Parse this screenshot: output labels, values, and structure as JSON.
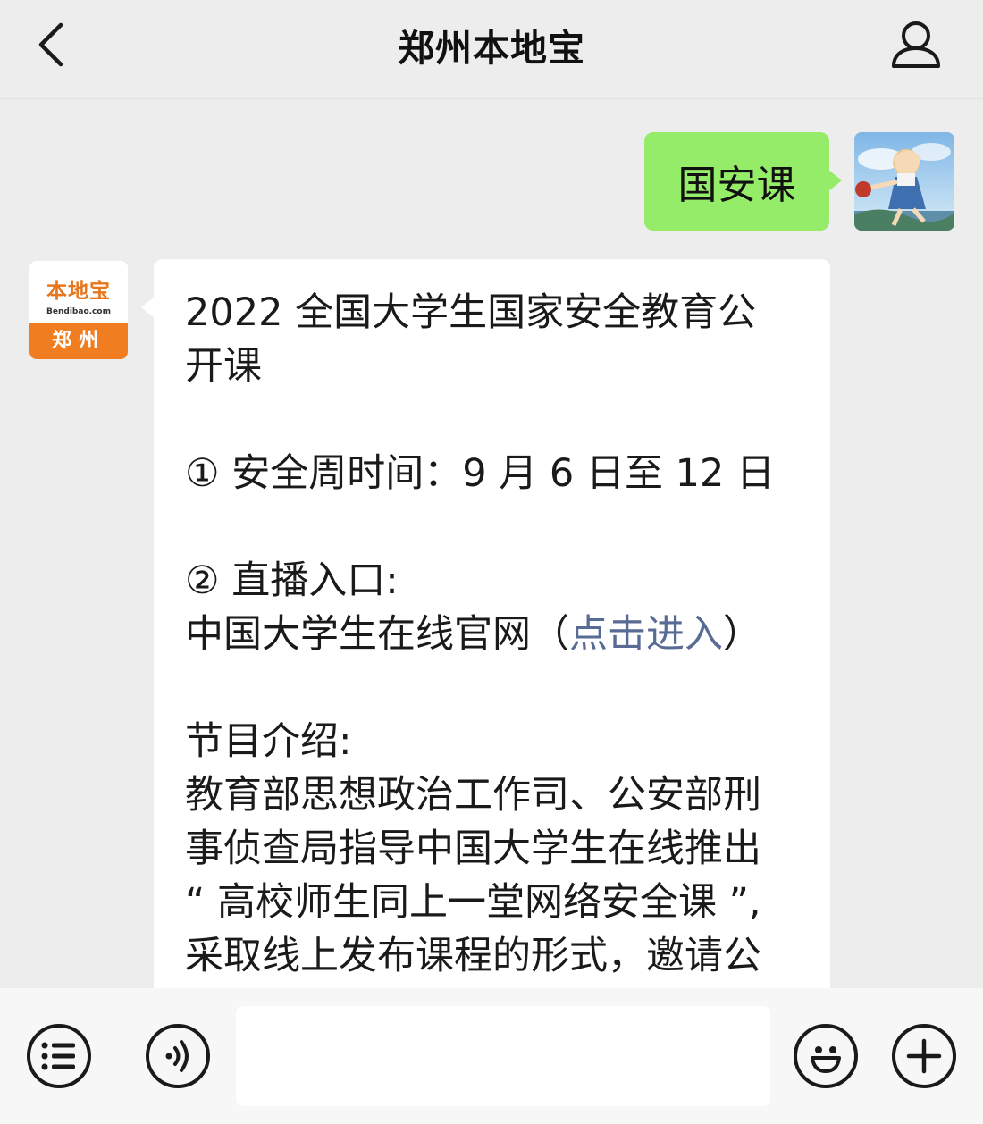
{
  "header": {
    "title": "郑州本地宝",
    "back_icon": "chevron-left-icon",
    "profile_icon": "user-icon"
  },
  "chat": {
    "sent_message": "国安课",
    "bot_avatar": {
      "logo_text": "本地宝",
      "logo_url_text": "Bendibao.com",
      "city_label": "郑州"
    },
    "received_message": {
      "title_line1": "2022 全国大学生国家安全教育公",
      "title_line2": "开课",
      "item1": "① 安全周时间：9 月 6 日至 12 日",
      "item2_label": "② 直播入口:",
      "item2_prefix": "中国大学生在线官网（",
      "item2_link": "点击进入",
      "item2_suffix": "）",
      "intro_label": "节目介绍:",
      "intro_line1": "教育部思想政治工作司、公安部刑",
      "intro_line2": "事侦查局指导中国大学生在线推出",
      "intro_line3": "“ 高校师生同上一堂网络安全课 ”,",
      "intro_line4": "采取线上发布课程的形式，邀请公"
    }
  },
  "bottom_bar": {
    "menu_icon": "list-menu-icon",
    "voice_icon": "voice-icon",
    "emoji_icon": "emoji-icon",
    "plus_icon": "plus-icon",
    "input_value": ""
  },
  "colors": {
    "background": "#ededed",
    "sent_bubble": "#95ec69",
    "link": "#576b95",
    "brand_orange": "#f07d1f"
  }
}
